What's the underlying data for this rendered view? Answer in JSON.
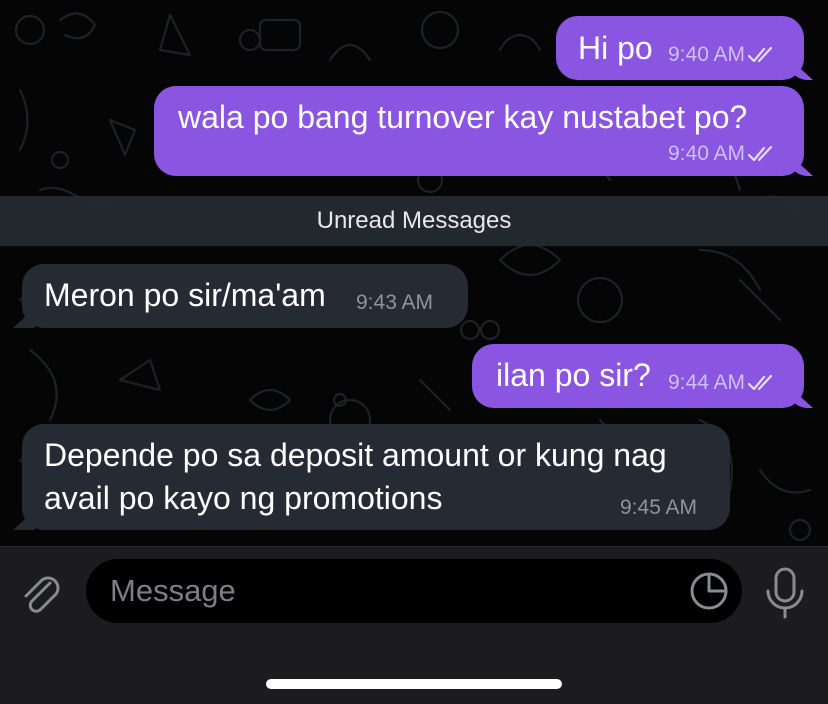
{
  "chat": {
    "unread_label": "Unread Messages",
    "messages": [
      {
        "direction": "outgoing",
        "lines": [
          "Hi po"
        ],
        "time": "9:40 AM",
        "status": "read"
      },
      {
        "direction": "outgoing",
        "lines": [
          "wala po bang turnover kay nustabet po?"
        ],
        "time": "9:40 AM",
        "status": "read"
      },
      {
        "direction": "incoming",
        "lines": [
          "Meron po sir/ma'am"
        ],
        "time": "9:43 AM"
      },
      {
        "direction": "outgoing",
        "lines": [
          "ilan po sir?"
        ],
        "time": "9:44 AM",
        "status": "read"
      },
      {
        "direction": "incoming",
        "lines": [
          "Depende po sa deposit amount or kung nag",
          "avail po kayo ng promotions"
        ],
        "time": "9:45 AM"
      }
    ]
  },
  "composer": {
    "placeholder": "Message",
    "value": ""
  },
  "icons": {
    "attach": "paperclip-icon",
    "sticker": "sticker-icon",
    "mic": "microphone-icon",
    "read_status": "double-check-icon"
  },
  "colors": {
    "outgoing_bubble": "#8a55e0",
    "incoming_bubble": "#262a32",
    "background": "#000000"
  }
}
